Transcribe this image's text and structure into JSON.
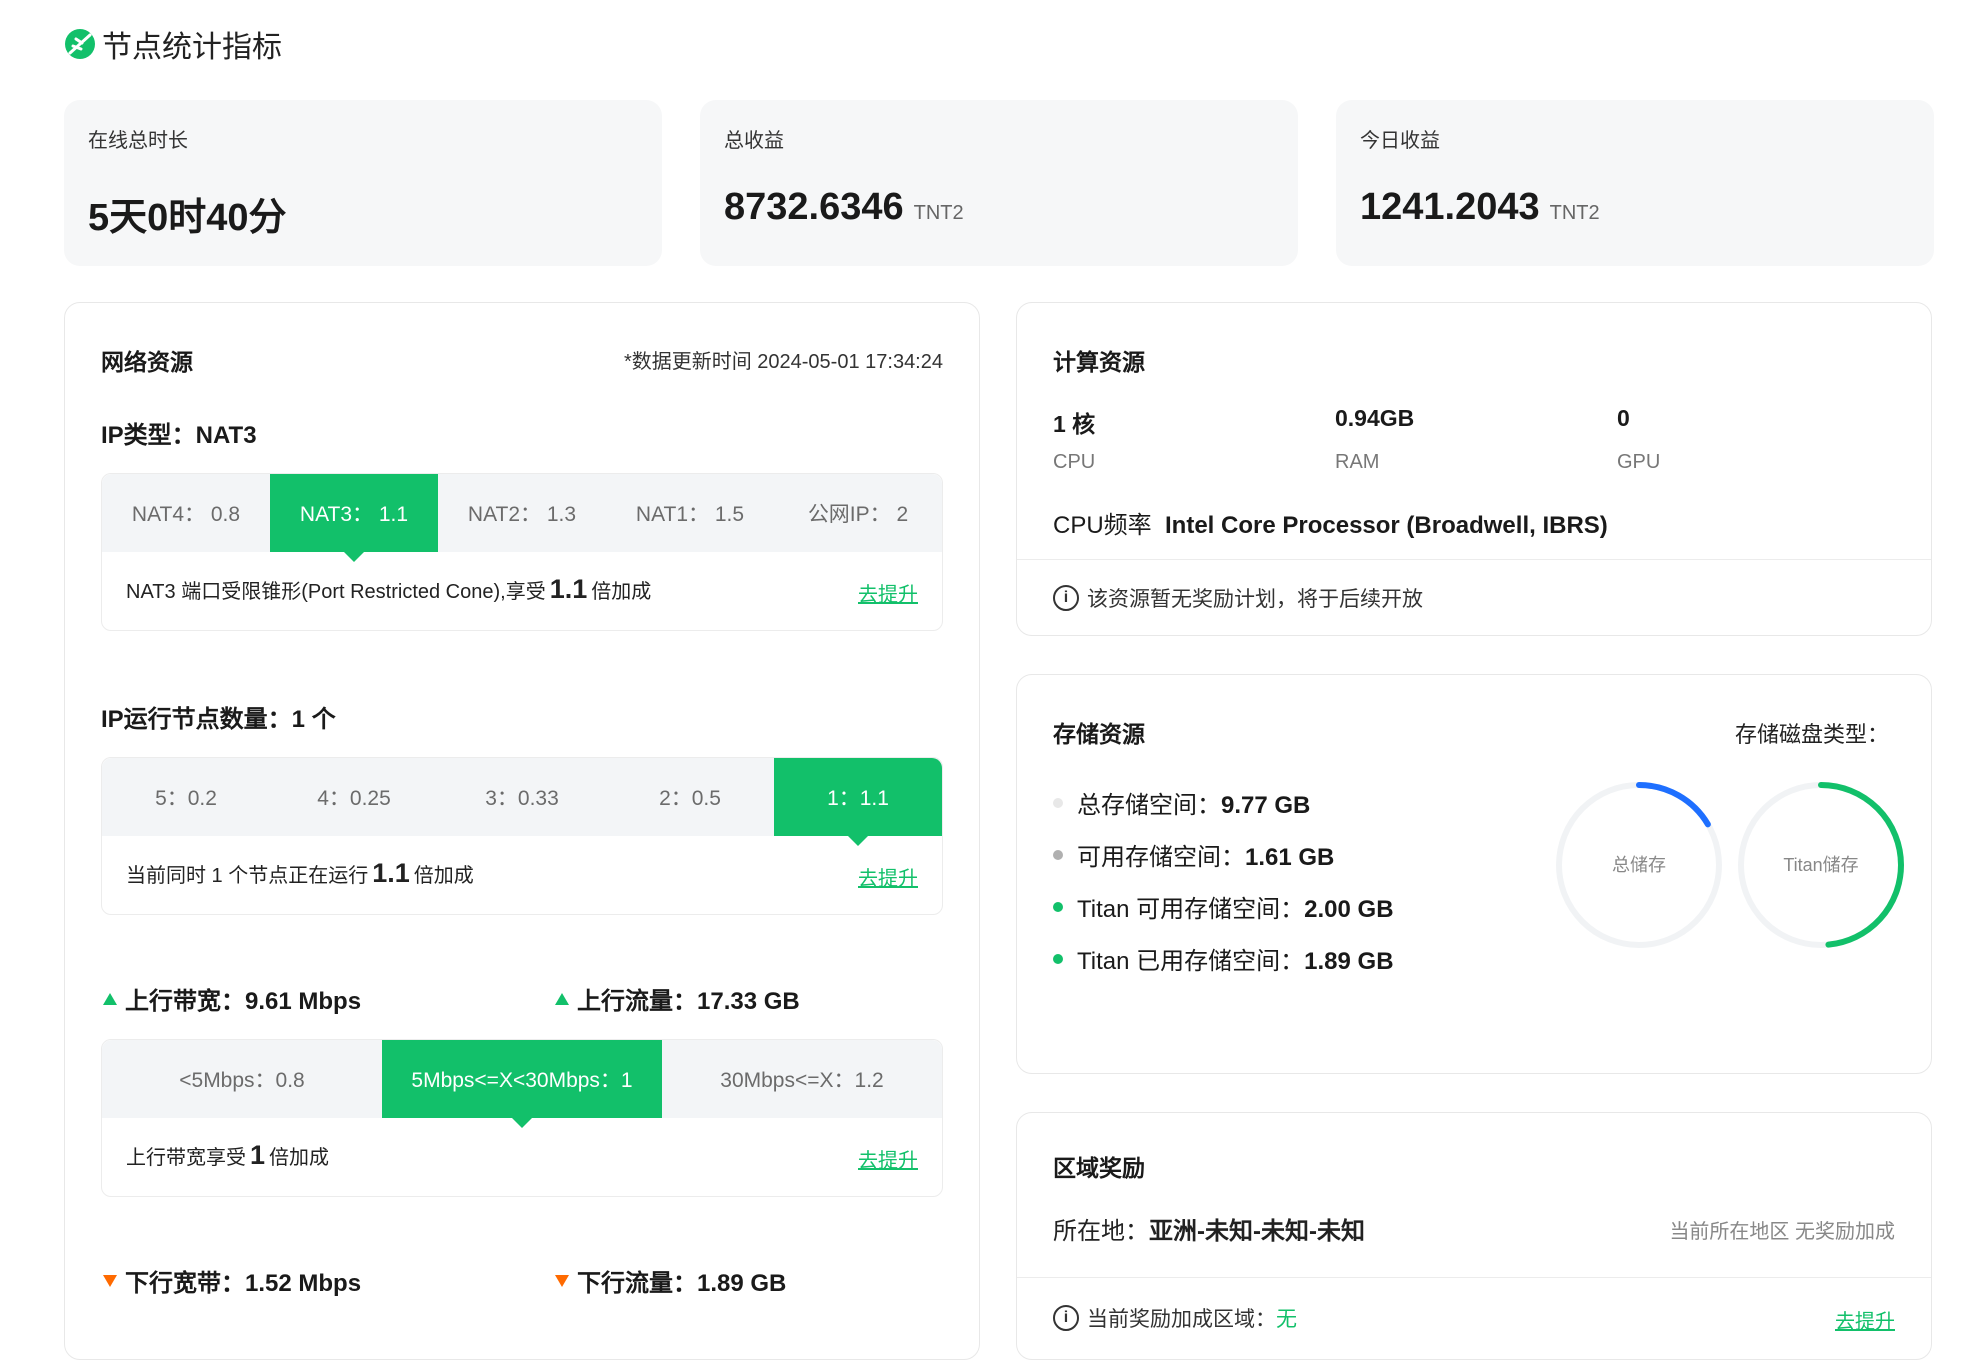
{
  "header": {
    "title": "节点统计指标",
    "logo_icon": "leaf-logo-icon"
  },
  "stats": [
    {
      "label": "在线总时长",
      "value": "5天0时40分",
      "unit": ""
    },
    {
      "label": "总收益",
      "value": "8732.6346",
      "unit": "TNT2"
    },
    {
      "label": "今日收益",
      "value": "1241.2043",
      "unit": "TNT2"
    }
  ],
  "network": {
    "title": "网络资源",
    "updated": "*数据更新时间 2024-05-01 17:34:24",
    "ip_type": {
      "label": "IP类型：NAT3",
      "options": [
        "NAT4： 0.8",
        "NAT3： 1.1",
        "NAT2： 1.3",
        "NAT1： 1.5",
        "公网IP： 2"
      ],
      "selected_index": 1,
      "desc_prefix": "NAT3 端口受限锥形(Port Restricted Cone),享受",
      "desc_value": "1.1",
      "desc_suffix": "倍加成",
      "link": "去提升"
    },
    "nodes": {
      "label": "IP运行节点数量：1 个",
      "options": [
        "5：0.2",
        "4：0.25",
        "3：0.33",
        "2：0.5",
        "1：1.1"
      ],
      "selected_index": 4,
      "desc_prefix": "当前同时 1 个节点正在运行",
      "desc_value": "1.1",
      "desc_suffix": "倍加成",
      "link": "去提升"
    },
    "upload_bandwidth": "上行带宽：9.61 Mbps",
    "upload_traffic": "上行流量：17.33 GB",
    "bandwidth": {
      "options": [
        "<5Mbps：0.8",
        "5Mbps<=X<30Mbps：1",
        "30Mbps<=X：1.2"
      ],
      "selected_index": 1,
      "desc_prefix": "上行带宽享受",
      "desc_value": "1",
      "desc_suffix": "倍加成",
      "link": "去提升"
    },
    "download_bandwidth": "下行宽带：1.52 Mbps",
    "download_traffic": "下行流量：1.89 GB",
    "colors": {
      "accent": "#12c06a",
      "up": "#12c06a",
      "down": "#ff6a00"
    }
  },
  "compute": {
    "title": "计算资源",
    "cpu_value": "1 核",
    "cpu_label": "CPU",
    "ram_value": "0.94GB",
    "ram_label": "RAM",
    "gpu_value": "0",
    "gpu_label": "GPU",
    "freq_label": "CPU频率",
    "freq_value": "Intel Core Processor (Broadwell, IBRS)",
    "notice": "该资源暂无奖励计划，将于后续开放"
  },
  "storage": {
    "title": "存储资源",
    "disk_type_label": "存储磁盘类型：",
    "items": [
      {
        "label": "总存储空间：",
        "value": "9.77 GB",
        "color": "#e8e8e8"
      },
      {
        "label": "可用存储空间：",
        "value": "1.61 GB",
        "color": "#b0b0b0"
      },
      {
        "label": "Titan 可用存储空间：",
        "value": "2.00 GB",
        "color": "#12c06a"
      },
      {
        "label": "Titan 已用存储空间：",
        "value": "1.89 GB",
        "color": "#12c06a"
      }
    ],
    "gauges": [
      {
        "label": "总储存",
        "fraction": 0.165,
        "color": "#1e6fff"
      },
      {
        "label": "Titan储存",
        "fraction": 0.485,
        "color": "#12c06a"
      }
    ]
  },
  "region": {
    "title": "区域奖励",
    "location_label": "所在地：",
    "location_value": "亚洲-未知-未知-未知",
    "bonus_note": "当前所在地区 无奖励加成",
    "current_label": "当前奖励加成区域：",
    "current_value": "无",
    "link": "去提升"
  }
}
